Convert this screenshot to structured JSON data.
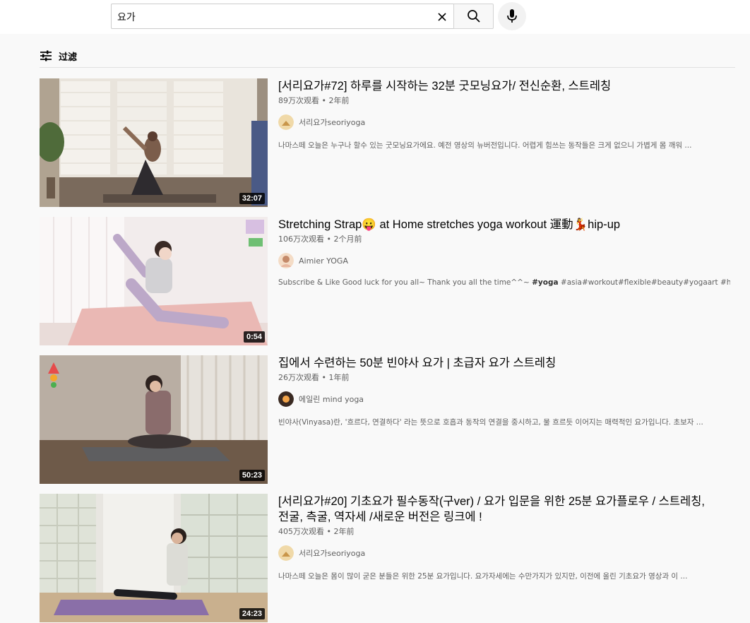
{
  "search": {
    "query": "요가"
  },
  "filter": {
    "label": "过滤"
  },
  "results": [
    {
      "title": "[서리요가#72] 하루를 시작하는 32분 굿모닝요가/ 전신순환, 스트레칭",
      "views": "89万次观看",
      "age": "2年前",
      "channel": "서리요가seoriyoga",
      "description": "나마스떼 오늘은 누구나 할수 있는 굿모닝요가에요. 예전 영상의 뉴버전입니다. 어렵게 힘쓰는 동작들은 크게 없으니 가볍게 몸 깨워 ...",
      "duration": "32:07"
    },
    {
      "title": "Stretching Strap😛 at Home stretches yoga workout 運動💃hip-up",
      "views": "106万次观看",
      "age": "2个月前",
      "channel": "Aimier YOGA",
      "description_prefix": "Subscribe & Like Good luck for you all~ Thank you all the time^^~ ",
      "description_bold": "#yoga",
      "description_suffix": " #asia#workout#flexible#beauty#yogaart #health# ...",
      "duration": "0:54"
    },
    {
      "title": "집에서 수련하는 50분 빈야사 요가 | 초급자 요가 스트레칭",
      "views": "26万次观看",
      "age": "1年前",
      "channel": "에일린 mind yoga",
      "description": "빈야사(Vinyasa)란, '흐르다, 연결하다' 라는 뜻으로 호흡과 동작의 연결을 중시하고, 물 흐르듯 이어지는 매력적인 요가입니다. 초보자 ...",
      "duration": "50:23"
    },
    {
      "title": "[서리요가#20] 기초요가 필수동작(구ver) / 요가 입문을 위한 25분 요가플로우 / 스트레칭, 전굴, 측굴, 역자세 /새로운 버전은 링크에 !",
      "views": "405万次观看",
      "age": "2年前",
      "channel": "서리요가seoriyoga",
      "description": "나마스떼 오늘은 몸이 많이 굳은 분들은 위한 25분 요가입니다. 요가자세에는 수만가지가 있지만, 이전에 올린 기초요가 영상과 이 ...",
      "duration": "24:23"
    }
  ],
  "separator": "•",
  "colors": {
    "page_bg": "#f9f9f9",
    "text_primary": "#030303",
    "text_secondary": "#606060"
  }
}
